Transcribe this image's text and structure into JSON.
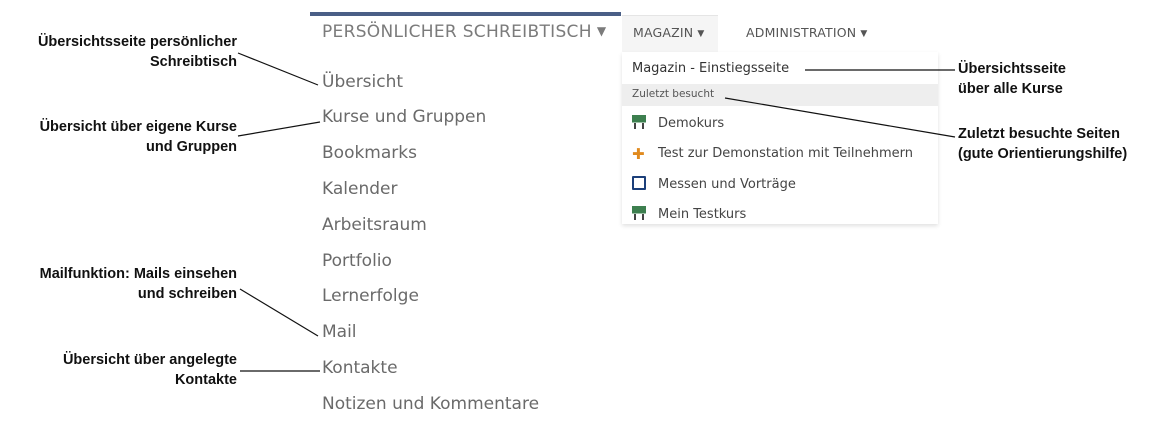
{
  "personal_desk": {
    "header": "PERSÖNLICHER SCHREIBTISCH",
    "items": [
      "Übersicht",
      "Kurse und Gruppen",
      "Bookmarks",
      "Kalender",
      "Arbeitsraum",
      "Portfolio",
      "Lernerfolge",
      "Mail",
      "Kontakte",
      "Notizen und Kommentare"
    ]
  },
  "nav": {
    "magazin": "MAGAZIN",
    "administration": "ADMINISTRATION"
  },
  "magazin_menu": {
    "entry": "Magazin - Einstiegsseite",
    "recent_label": "Zuletzt besucht",
    "recent": [
      {
        "label": "Demokurs",
        "icon": "course-icon"
      },
      {
        "label": "Test zur Demonstation mit Teilnehmern",
        "icon": "test-icon"
      },
      {
        "label": "Messen und Vorträge",
        "icon": "folder-icon"
      },
      {
        "label": "Mein Testkurs",
        "icon": "course-icon"
      }
    ]
  },
  "annotations": {
    "overview_desk": [
      "Übersichtsseite persönlicher",
      "Schreibtisch"
    ],
    "courses_groups": [
      "Übersicht über eigene Kurse",
      "und Gruppen"
    ],
    "mail": [
      "Mailfunktion: Mails einsehen",
      "und schreiben"
    ],
    "contacts": [
      "Übersicht über angelegte",
      "Kontakte"
    ],
    "all_courses": [
      "Übersichtsseite",
      "über alle Kurse"
    ],
    "recent_pages": [
      "Zuletzt besuchte Seiten",
      "(gute Orientierungshilfe)"
    ]
  },
  "colors": {
    "topbar": "#4a5f86",
    "menu_text": "#6a6a6a",
    "course_icon": "#3d7f4f",
    "test_icon": "#e08a1e",
    "folder_icon": "#1c3f7a"
  }
}
